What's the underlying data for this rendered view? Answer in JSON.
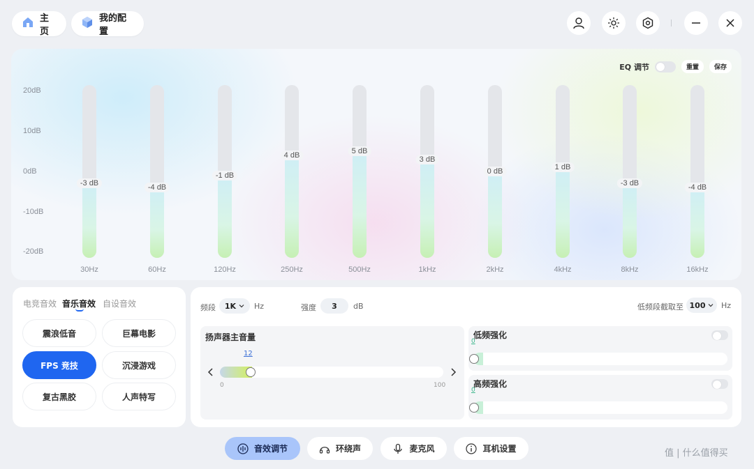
{
  "header": {
    "home_label": "主页",
    "config_label": "我的配置"
  },
  "eq": {
    "title": "EQ 调节",
    "reset_label": "重置",
    "save_label": "保存",
    "y_ticks": [
      "20dB",
      "10dB",
      "0dB",
      "-10dB",
      "-20dB"
    ],
    "bands": [
      {
        "freq": "30Hz",
        "gain": -3,
        "label": "-3 dB"
      },
      {
        "freq": "60Hz",
        "gain": -4,
        "label": "-4 dB"
      },
      {
        "freq": "120Hz",
        "gain": -1,
        "label": "-1 dB"
      },
      {
        "freq": "250Hz",
        "gain": 4,
        "label": "4 dB"
      },
      {
        "freq": "500Hz",
        "gain": 5,
        "label": "5 dB"
      },
      {
        "freq": "1kHz",
        "gain": 3,
        "label": "3 dB"
      },
      {
        "freq": "2kHz",
        "gain": 0,
        "label": "0 dB"
      },
      {
        "freq": "4kHz",
        "gain": 1,
        "label": "1 dB"
      },
      {
        "freq": "8kHz",
        "gain": -3,
        "label": "-3 dB"
      },
      {
        "freq": "16kHz",
        "gain": -4,
        "label": "-4 dB"
      }
    ]
  },
  "presets": {
    "tabs": [
      "电竞音效",
      "音乐音效",
      "自设音效"
    ],
    "active_tab": 1,
    "buttons": [
      "震浪低音",
      "巨幕电影",
      "FPS 竞技",
      "沉浸游戏",
      "复古黑胶",
      "人声特写"
    ],
    "active_button": 2
  },
  "settings": {
    "freq_label": "频段",
    "freq_value": "1K",
    "freq_unit": "Hz",
    "intensity_label": "强度",
    "intensity_value": "3",
    "intensity_unit": "dB",
    "lowcut_label": "低频段截取至",
    "lowcut_value": "100",
    "lowcut_unit": "Hz",
    "volume_title": "扬声器主音量",
    "volume_value": "12",
    "volume_min": "0",
    "volume_max": "100",
    "bass_title": "低频强化",
    "bass_value": "0",
    "treble_title": "高频强化",
    "treble_value": "0"
  },
  "bottom_nav": [
    "音效调节",
    "环绕声",
    "麦克风",
    "耳机设置"
  ],
  "watermark": "值 | 什么值得买"
}
